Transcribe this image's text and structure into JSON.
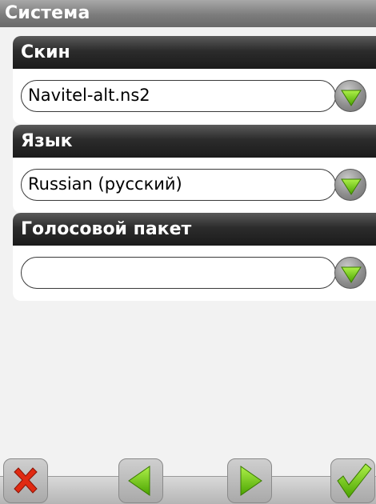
{
  "title": "Система",
  "sections": [
    {
      "header": "Скин",
      "value": "Navitel-alt.ns2"
    },
    {
      "header": "Язык",
      "value": "Russian (русский)"
    },
    {
      "header": "Голосовой пакет",
      "value": ""
    }
  ],
  "toolbar": {
    "buttons": [
      "cancel",
      "back",
      "forward",
      "confirm"
    ]
  },
  "colors": {
    "accent_green": "#5cb800",
    "cancel_red": "#e02a12",
    "header_dark": "#222222"
  },
  "icons": {
    "dropdown": "chevron-down-icon",
    "cancel": "x-icon",
    "back": "arrow-left-icon",
    "forward": "arrow-right-icon",
    "confirm": "checkmark-icon"
  }
}
